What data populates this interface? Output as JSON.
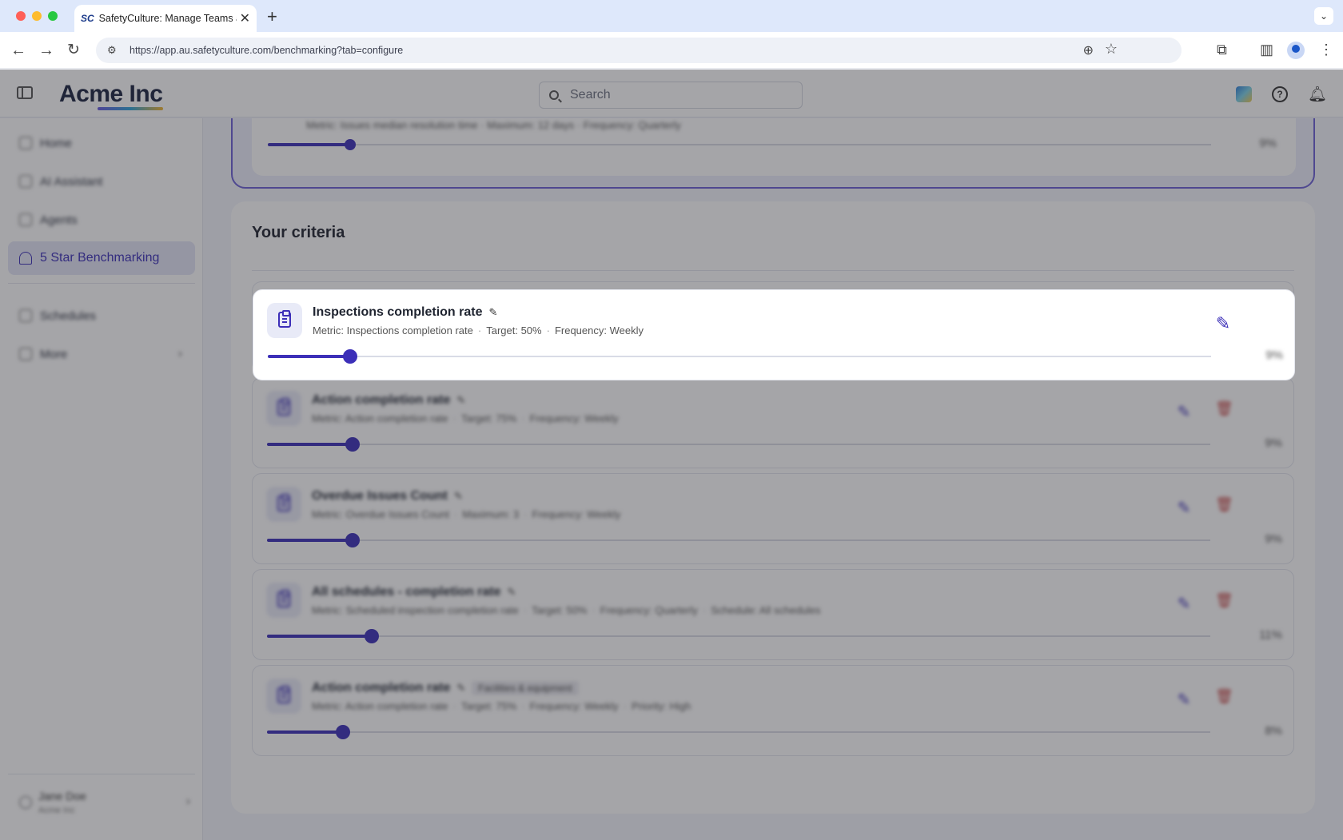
{
  "browser": {
    "tab_title": "SafetyCulture: Manage Teams and...",
    "tab_favicon": "SC",
    "url": "https://app.au.safetyculture.com/benchmarking?tab=configure"
  },
  "header": {
    "logo": "Acme Inc",
    "search_placeholder": "Search"
  },
  "sidebar": {
    "items": [
      {
        "label": "Home"
      },
      {
        "label": "AI Assistant"
      },
      {
        "label": "Agents"
      },
      {
        "label": "5 Star Benchmarking"
      },
      {
        "label": "Schedules"
      },
      {
        "label": "More"
      }
    ],
    "user": {
      "name": "Jane Doe",
      "org": "Acme Inc"
    }
  },
  "top_card": {
    "meta": "Metric: Issues median resolution time · Maximum: 12 days · Frequency: Quarterly",
    "percent": "9%",
    "progress": 0.09
  },
  "criteria": {
    "title": "Your criteria",
    "rows": [
      {
        "name": "Inspections completion rate",
        "metric": "Metric: Inspections completion rate",
        "target": "Target: 50%",
        "frequency": "Frequency: Weekly",
        "extra": "",
        "badge": "",
        "percent": "9%",
        "progress": 0.09
      },
      {
        "name": "Action completion rate",
        "metric": "Metric: Action completion rate",
        "target": "Target: 75%",
        "frequency": "Frequency: Weekly",
        "extra": "",
        "badge": "",
        "percent": "9%",
        "progress": 0.09
      },
      {
        "name": "Overdue Issues Count",
        "metric": "Metric: Overdue Issues Count",
        "target": "Maximum: 3",
        "frequency": "Frequency: Weekly",
        "extra": "",
        "badge": "",
        "percent": "9%",
        "progress": 0.09
      },
      {
        "name": "All schedules - completion rate",
        "metric": "Metric: Scheduled inspection completion rate",
        "target": "Target: 50%",
        "frequency": "Frequency: Quarterly",
        "extra": "Schedule: All schedules",
        "badge": "",
        "percent": "11%",
        "progress": 0.11
      },
      {
        "name": "Action completion rate",
        "metric": "Metric: Action completion rate",
        "target": "Target: 75%",
        "frequency": "Frequency: Weekly",
        "extra": "Priority: High",
        "badge": "Facilities & equipment",
        "percent": "8%",
        "progress": 0.08
      }
    ]
  },
  "colors": {
    "accent": "#3c2fb8",
    "danger": "#c23b3b"
  },
  "icons": {
    "edit": "pencil-icon",
    "delete": "trash-icon",
    "criteria": "clipboard-icon"
  }
}
